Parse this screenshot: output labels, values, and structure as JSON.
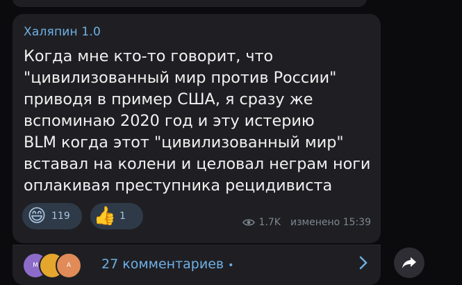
{
  "post": {
    "sender": "Халяпин 1.0",
    "text": "Когда мне кто-то говорит, что\n\"цивилизованный мир против России\"\nприводя в пример США, я сразу же\nвспоминаю 2020 год  и эту истерию\nBLM когда этот \"цивилизованный мир\"\nвставал на колени и целовал неграм ноги\nоплакивая преступника рецидивиста",
    "reactions": [
      {
        "emoji": "😄",
        "count": "119"
      },
      {
        "emoji": "👍",
        "count": "1"
      }
    ],
    "views": "1.7K",
    "edited_time": "изменено 15:39"
  },
  "comments": {
    "avatars": [
      "M",
      "",
      "A"
    ],
    "label": "27 комментариев",
    "dot": "•"
  },
  "colors": {
    "accent": "#6fb0e6",
    "bubble": "#1f1f23",
    "background": "#0b0b0d"
  }
}
